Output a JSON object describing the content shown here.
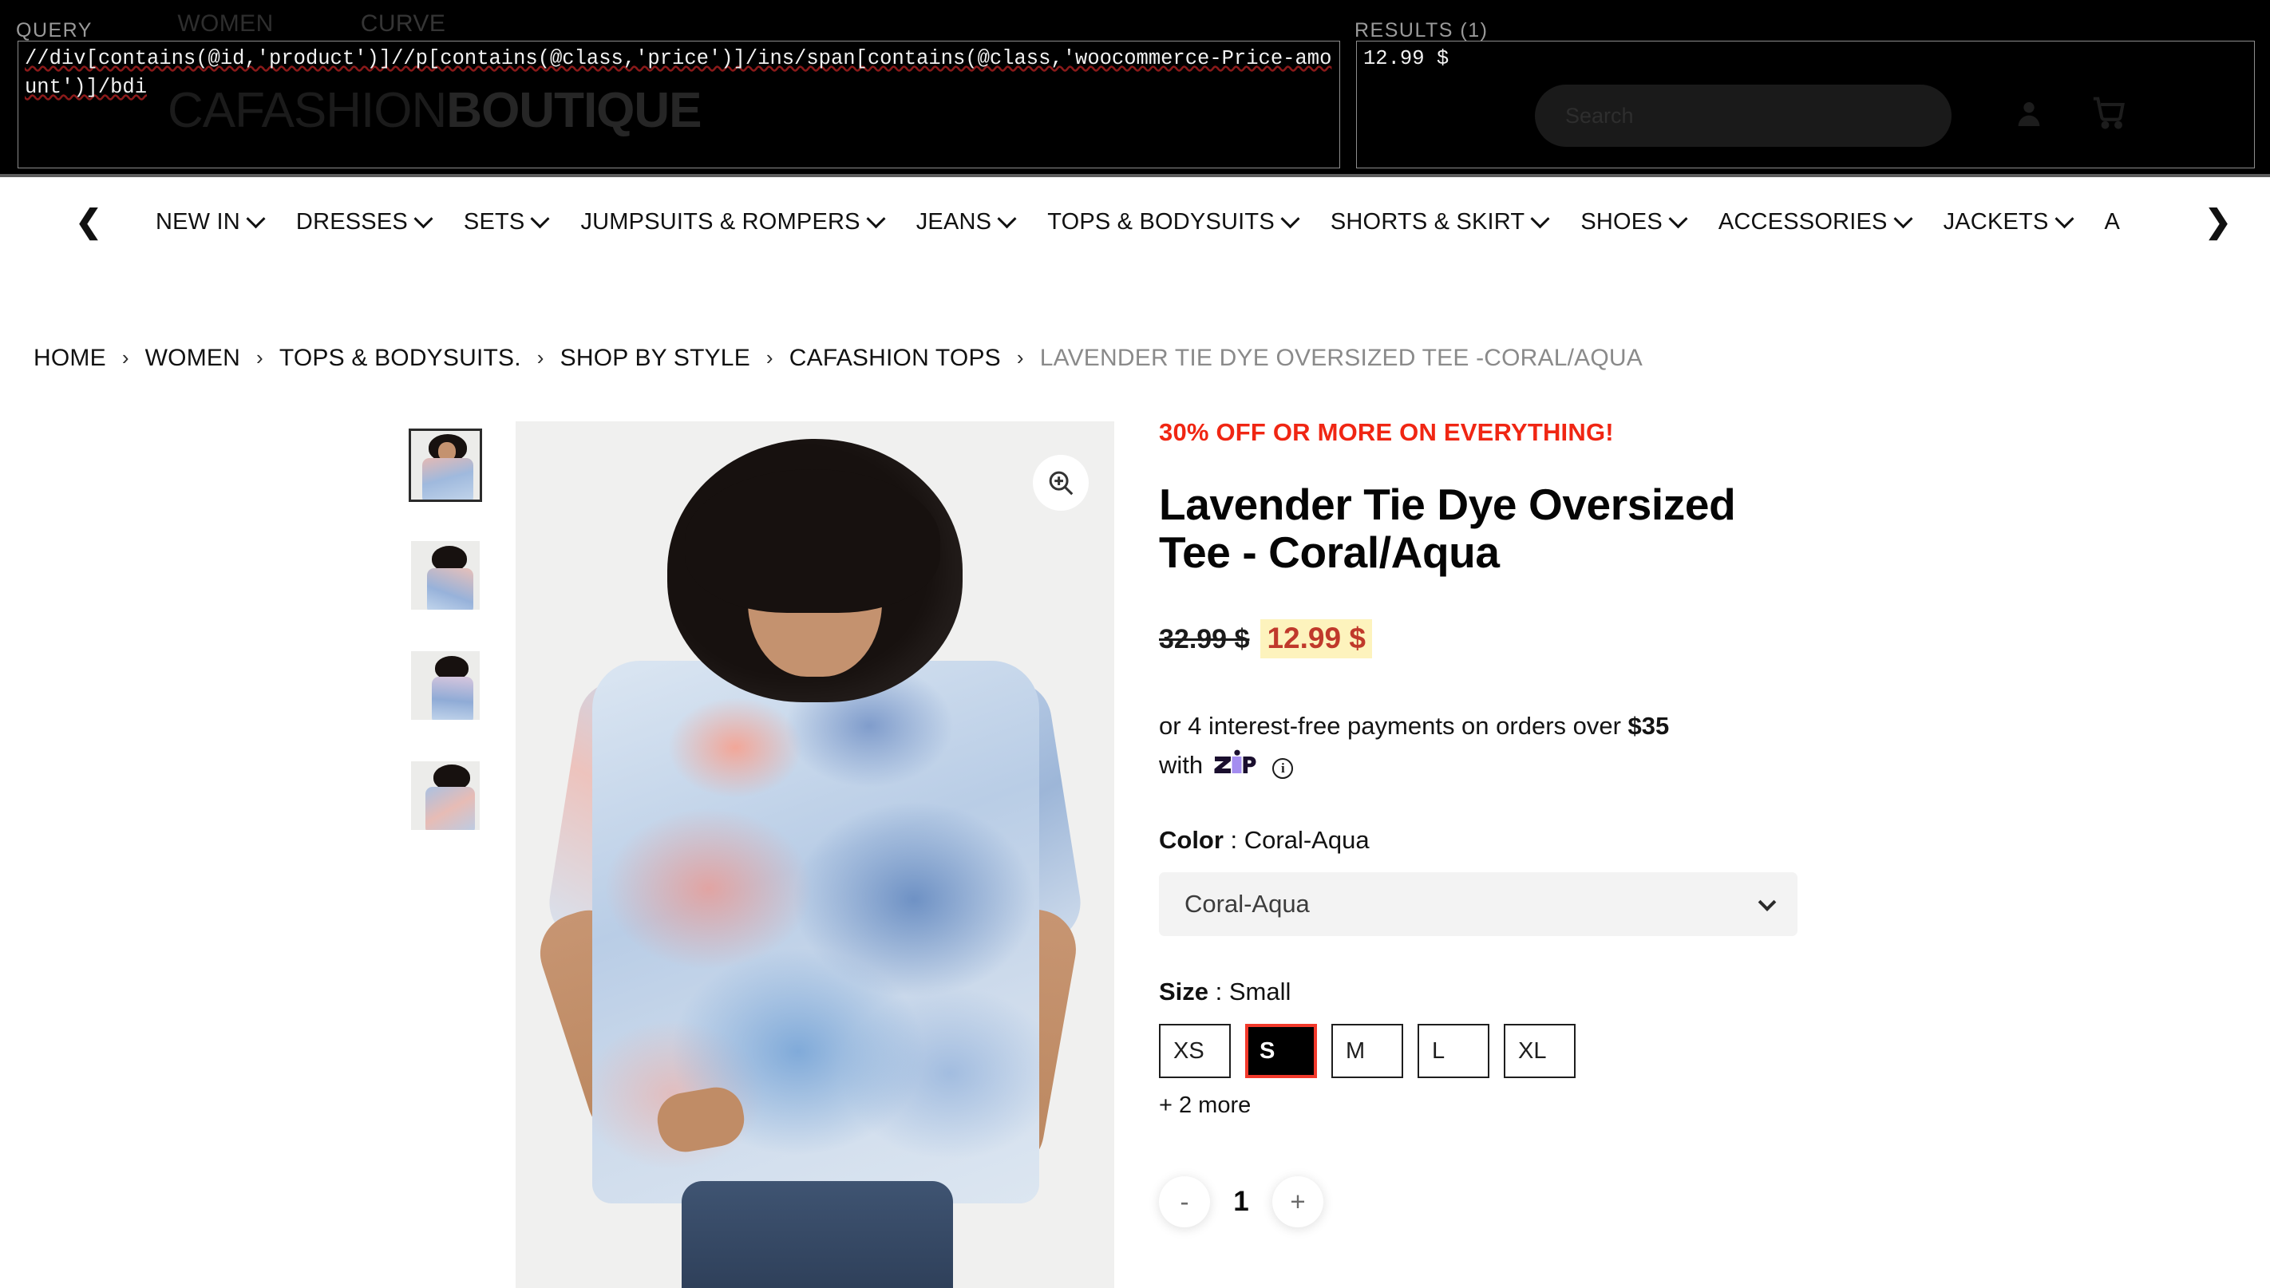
{
  "devtools": {
    "query_label": "QUERY",
    "query_value": "//div[contains(@id,'product')]//p[contains(@class,'price')]/ins/span[contains(@class,'woocommerce-Price-amount')]/bdi",
    "results_label": "RESULTS (1)",
    "results_value": "12.99 $"
  },
  "header": {
    "tabs": [
      {
        "label": "WOMEN",
        "active": true
      },
      {
        "label": "CURVE",
        "active": false
      }
    ],
    "logo_thin": "CAFASHION",
    "logo_bold": "BOUTIQUE",
    "search_placeholder": "Search",
    "account_icon": "account-icon",
    "cart_icon": "cart-icon"
  },
  "nav": {
    "prev_arrow": "❮",
    "next_arrow": "❯",
    "items": [
      {
        "label": "NEW IN",
        "caret": true
      },
      {
        "label": "DRESSES",
        "caret": true
      },
      {
        "label": "SETS",
        "caret": true
      },
      {
        "label": "JUMPSUITS & ROMPERS",
        "caret": true
      },
      {
        "label": "JEANS",
        "caret": true
      },
      {
        "label": "TOPS & BODYSUITS",
        "caret": true
      },
      {
        "label": "SHORTS & SKIRT",
        "caret": true
      },
      {
        "label": "SHOES",
        "caret": true
      },
      {
        "label": "ACCESSORIES",
        "caret": true
      },
      {
        "label": "JACKETS",
        "caret": true
      },
      {
        "label": "A",
        "caret": false
      }
    ]
  },
  "breadcrumb": {
    "separator": "›",
    "items": [
      {
        "label": "HOME",
        "current": false
      },
      {
        "label": "WOMEN",
        "current": false
      },
      {
        "label": "TOPS & BODYSUITS.",
        "current": false
      },
      {
        "label": "SHOP BY STYLE",
        "current": false
      },
      {
        "label": "CAFASHION TOPS",
        "current": false
      },
      {
        "label": "LAVENDER TIE DYE OVERSIZED TEE -CORAL/AQUA",
        "current": true
      }
    ]
  },
  "gallery": {
    "zoom_icon": "zoom-in-icon",
    "thumbnails": [
      {
        "alt": "Lavender Tie Dye Oversized Tee front view",
        "selected": true
      },
      {
        "alt": "Lavender Tie Dye Oversized Tee side view",
        "selected": false
      },
      {
        "alt": "Lavender Tie Dye Oversized Tee profile view",
        "selected": false
      },
      {
        "alt": "Lavender Tie Dye Oversized Tee back view",
        "selected": false
      }
    ],
    "main_alt": "Model wearing Lavender Tie Dye Oversized Tee in Coral/Aqua"
  },
  "product": {
    "promo": "30% OFF OR MORE ON EVERYTHING!",
    "title": "Lavender Tie Dye Oversized Tee - Coral/Aqua",
    "price_old": "32.99 $",
    "price_new": "12.99 $",
    "finance_prefix": "or 4 interest-free payments on orders over ",
    "finance_amount": "$35",
    "finance_with": "with",
    "finance_brand": "zip",
    "finance_info_icon": "info-icon",
    "color_label": "Color",
    "color_value": "Coral-Aqua",
    "color_selected_option": "Coral-Aqua",
    "size_label": "Size",
    "size_value": "Small",
    "sizes": [
      {
        "label": "XS",
        "selected": false
      },
      {
        "label": "S",
        "selected": true
      },
      {
        "label": "M",
        "selected": false
      },
      {
        "label": "L",
        "selected": false
      },
      {
        "label": "XL",
        "selected": false
      }
    ],
    "more_sizes": "+ 2 more",
    "qty_minus": "-",
    "qty_value": "1",
    "qty_plus": "+"
  },
  "colors": {
    "promo_red": "#f02613",
    "price_red": "#c0392b",
    "price_highlight": "#fdf3bd",
    "selected_size_border": "#f2392b",
    "zip_purple": "#a48df0",
    "zip_navy": "#1a0e2e"
  }
}
